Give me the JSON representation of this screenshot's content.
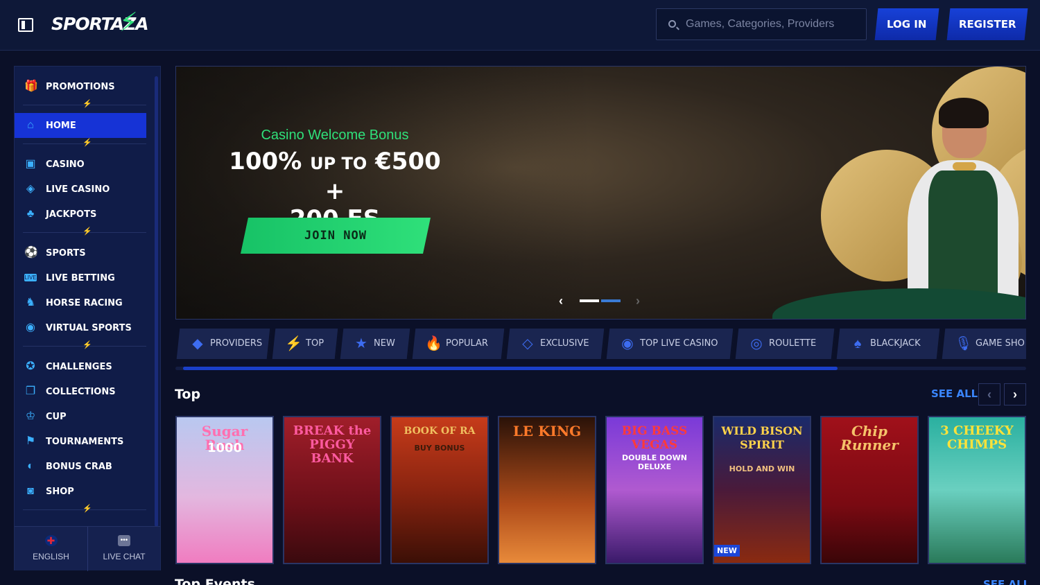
{
  "header": {
    "logo": "SPORTAZA",
    "search_placeholder": "Games, Categories, Providers",
    "login_label": "LOG IN",
    "register_label": "REGISTER"
  },
  "sidebar": {
    "items": [
      {
        "label": "PROMOTIONS",
        "icon": "gift-icon",
        "active": false
      },
      {
        "label": "HOME",
        "icon": "home-icon",
        "active": true
      },
      {
        "label": "CASINO",
        "icon": "slot-machine-icon",
        "active": false
      },
      {
        "label": "LIVE CASINO",
        "icon": "card-icon",
        "active": false
      },
      {
        "label": "JACKPOTS",
        "icon": "clover-icon",
        "active": false
      },
      {
        "label": "SPORTS",
        "icon": "soccer-ball-icon",
        "active": false
      },
      {
        "label": "LIVE BETTING",
        "icon": "live-badge-icon",
        "active": false
      },
      {
        "label": "HORSE RACING",
        "icon": "horse-icon",
        "active": false
      },
      {
        "label": "VIRTUAL SPORTS",
        "icon": "virtual-icon",
        "active": false
      },
      {
        "label": "CHALLENGES",
        "icon": "medal-icon",
        "active": false
      },
      {
        "label": "COLLECTIONS",
        "icon": "collections-icon",
        "active": false
      },
      {
        "label": "CUP",
        "icon": "trophy-icon",
        "active": false
      },
      {
        "label": "TOURNAMENTS",
        "icon": "checkered-flag-icon",
        "active": false
      },
      {
        "label": "BONUS CRAB",
        "icon": "crab-icon",
        "active": false
      },
      {
        "label": "SHOP",
        "icon": "shop-icon",
        "active": false
      }
    ],
    "language_label": "ENGLISH",
    "chat_label": "LIVE CHAT"
  },
  "banner": {
    "subtitle": "Casino Welcome Bonus",
    "title_line1": "100% ",
    "title_small": "UP TO",
    "title_line1b": " €500 +",
    "title_line2": "200 FS",
    "cta_label": "JOIN NOW"
  },
  "categories": [
    {
      "label": "PROVIDERS",
      "icon": "providers-icon"
    },
    {
      "label": "TOP",
      "icon": "lightning-icon"
    },
    {
      "label": "NEW",
      "icon": "star-icon"
    },
    {
      "label": "POPULAR",
      "icon": "fire-icon"
    },
    {
      "label": "EXCLUSIVE",
      "icon": "diamond-icon"
    },
    {
      "label": "TOP LIVE CASINO",
      "icon": "chips-icon"
    },
    {
      "label": "ROULETTE",
      "icon": "roulette-icon"
    },
    {
      "label": "BLACKJACK",
      "icon": "cards-icon"
    },
    {
      "label": "GAME SHO",
      "icon": "microphone-icon"
    }
  ],
  "top_section": {
    "title": "Top",
    "see_all": "SEE ALL",
    "games": [
      {
        "title": "Sugar Rush",
        "subtitle": "1000",
        "badge": ""
      },
      {
        "title": "BREAK the PIGGY BANK",
        "subtitle": "",
        "badge": ""
      },
      {
        "title": "BOOK OF RA",
        "subtitle": "BUY BONUS",
        "badge": ""
      },
      {
        "title": "LE KING",
        "subtitle": "",
        "badge": ""
      },
      {
        "title": "BIG BASS VEGAS",
        "subtitle": "DOUBLE DOWN DELUXE",
        "badge": ""
      },
      {
        "title": "WILD BISON SPIRIT",
        "subtitle": "HOLD AND WIN",
        "badge": "NEW"
      },
      {
        "title": "Chip Runner",
        "subtitle": "",
        "badge": ""
      },
      {
        "title": "3 CHEEKY CHIMPS",
        "subtitle": "",
        "badge": ""
      }
    ]
  },
  "next_section": {
    "title": "Top Events",
    "see_all": "SEE ALL"
  }
}
